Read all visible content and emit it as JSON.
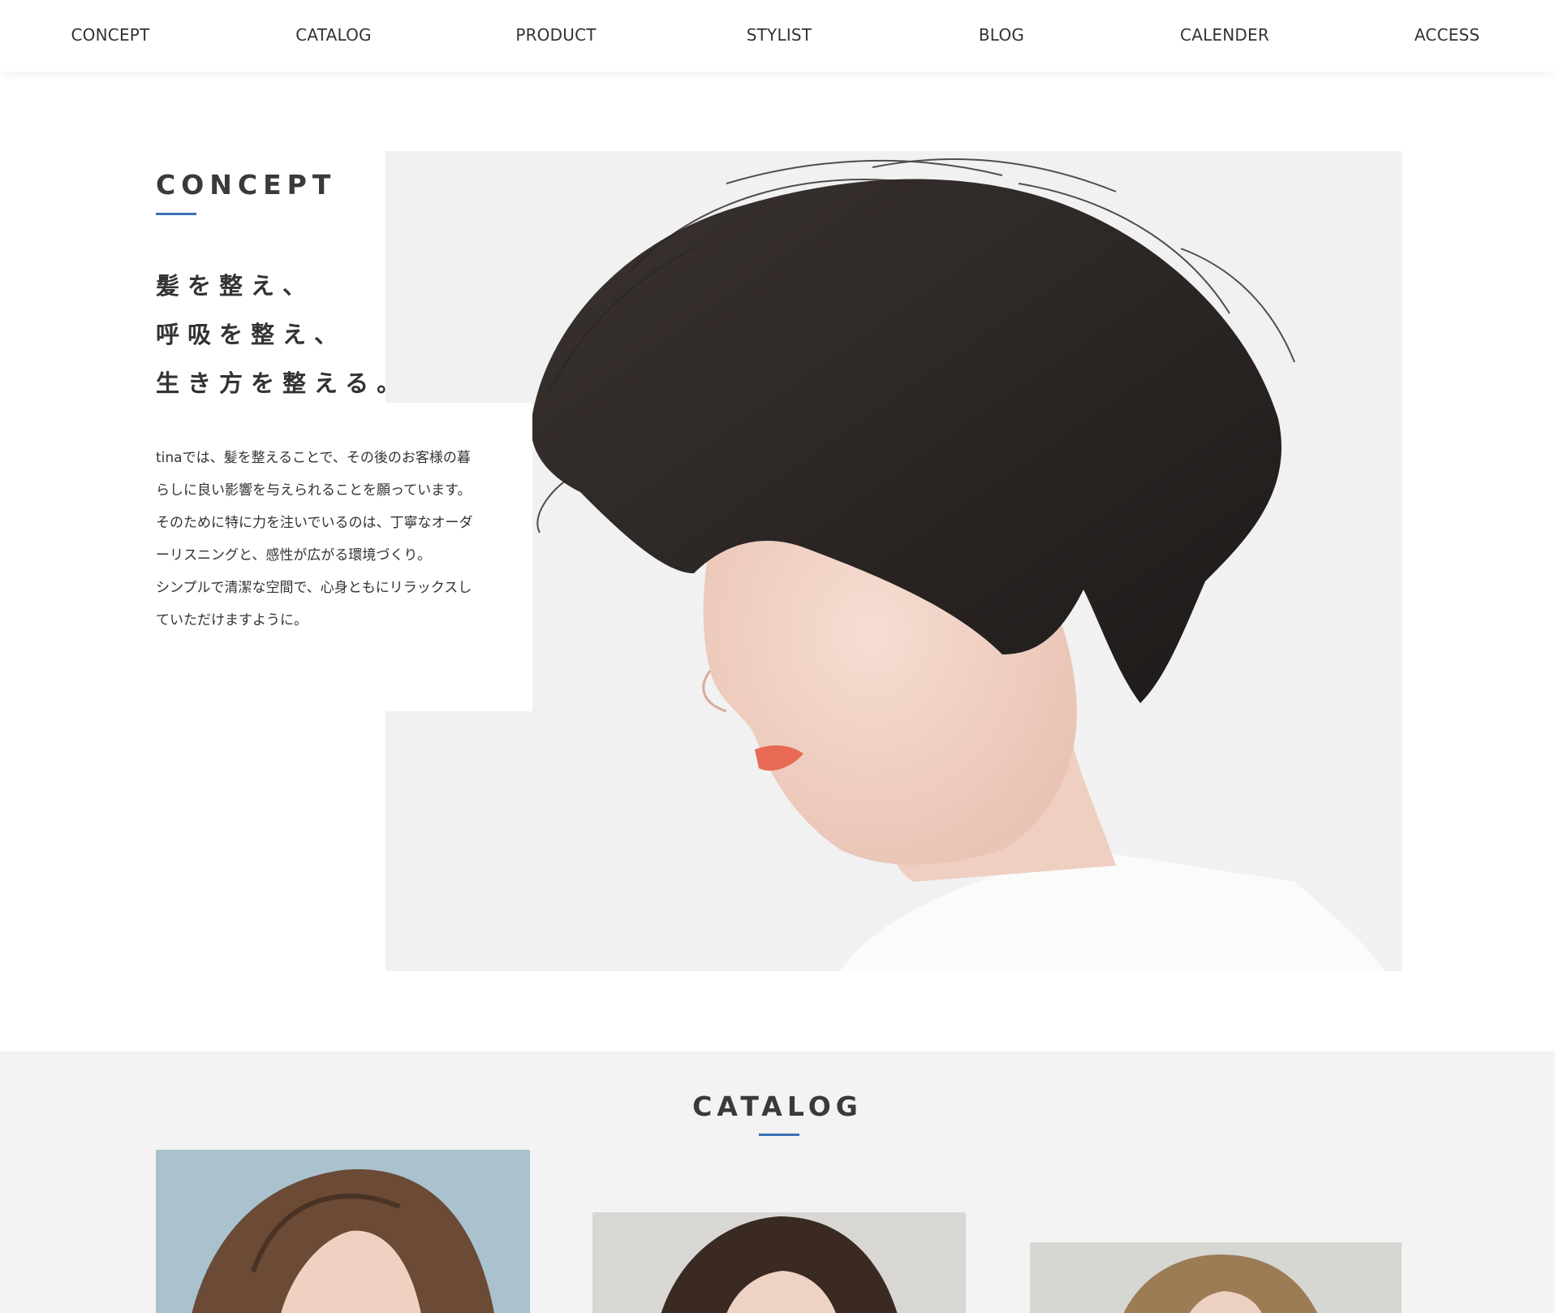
{
  "nav": {
    "items": [
      {
        "label": "CONCEPT"
      },
      {
        "label": "CATALOG"
      },
      {
        "label": "PRODUCT"
      },
      {
        "label": "STYLIST"
      },
      {
        "label": "BLOG"
      },
      {
        "label": "CALENDER"
      },
      {
        "label": "ACCESS"
      }
    ]
  },
  "concept": {
    "title": "CONCEPT",
    "catch_lines": [
      "髪を整え、",
      "呼吸を整え、",
      "生き方を整える。"
    ],
    "body_paragraphs": [
      "tinaでは、髪を整えることで、その後のお客様の暮らしに良い影響を与えられることを願っています。そのために特に力を注いでいるのは、丁寧なオーダーリスニングと、感性が広がる環境づくり。",
      "シンプルで清潔な空間で、心身ともにリラックスしていただけますように。"
    ],
    "accent_color": "#3d6fb6"
  },
  "catalog": {
    "title": "CATALOG",
    "accent_color": "#3d6fb6"
  }
}
